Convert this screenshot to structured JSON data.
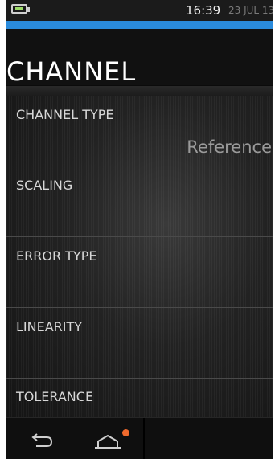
{
  "status_bar": {
    "time": "16:39",
    "date": "23 JUL 13",
    "battery_icon": "battery-charging-icon"
  },
  "colors": {
    "accent": "#2a8bdc",
    "notification": "#f06a2d"
  },
  "header": {
    "title": "CHANNEL"
  },
  "menu": {
    "items": [
      {
        "label": "CHANNEL TYPE",
        "value": "Reference"
      },
      {
        "label": "SCALING"
      },
      {
        "label": "ERROR TYPE"
      },
      {
        "label": "LINEARITY"
      },
      {
        "label": "TOLERANCE"
      }
    ]
  },
  "navbar": {
    "back_icon": "back-arrow-icon",
    "home_icon": "home-icon"
  }
}
